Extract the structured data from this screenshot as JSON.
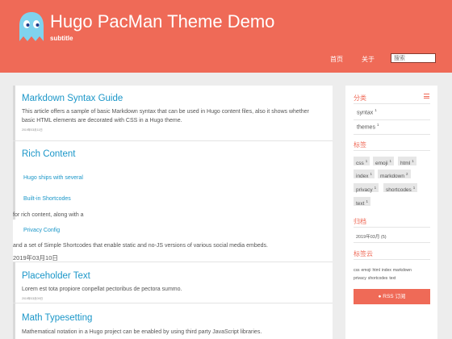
{
  "header": {
    "title": "Hugo PacMan Theme Demo",
    "subtitle": "subtitle",
    "nav": {
      "home": "首页",
      "about": "关于"
    },
    "search_placeholder": "搜索",
    "accent": "#ef6a57"
  },
  "posts": {
    "markdown": {
      "title": "Markdown Syntax Guide",
      "summary": "This article offers a sample of basic Markdown syntax that can be used in Hugo content files, also it shows whether basic HTML elements are decorated with CSS in a Hugo theme.",
      "date": "2019年03月11日"
    },
    "rich": {
      "title": "Rich Content",
      "link1": "Hugo ships with several",
      "link2": "Built-in Shortcodes",
      "text1": "for rich content, along with a",
      "link3": "Privacy Config",
      "text2": "and a set of Simple Shortcodes that enable static and no-JS versions of various social media embeds.",
      "date": "2019年03月10日"
    },
    "placeholder": {
      "title": "Placeholder Text",
      "summary": "Lorem est tota propiore conpellat pectoribus de pectora summo.",
      "date": "2019年03月09日"
    },
    "math": {
      "title": "Math Typesetting",
      "summary": "Mathematical notation in a Hugo project can be enabled by using third party JavaScript libraries."
    }
  },
  "sidebar": {
    "categories_title": "分类",
    "categories": [
      {
        "name": "syntax",
        "count": "1"
      },
      {
        "name": "themes",
        "count": "1"
      }
    ],
    "tags_title": "标签",
    "tags": [
      {
        "name": "css",
        "count": "1"
      },
      {
        "name": "emoji",
        "count": "1"
      },
      {
        "name": "html",
        "count": "1"
      },
      {
        "name": "index",
        "count": "1"
      },
      {
        "name": "markdown",
        "count": "2"
      },
      {
        "name": "privacy",
        "count": "1"
      },
      {
        "name": "shortcodes",
        "count": "1"
      },
      {
        "name": "text",
        "count": "1"
      }
    ],
    "archive_title": "归档",
    "archive_item": "2019年03月 (5)",
    "cloud_title": "标签云",
    "cloud": [
      "css",
      "emoji",
      "html",
      "index",
      "markdown",
      "privacy",
      "shortcodes",
      "text"
    ],
    "rss_label": "RSS 订阅",
    "rss_icon": "rss-icon"
  }
}
